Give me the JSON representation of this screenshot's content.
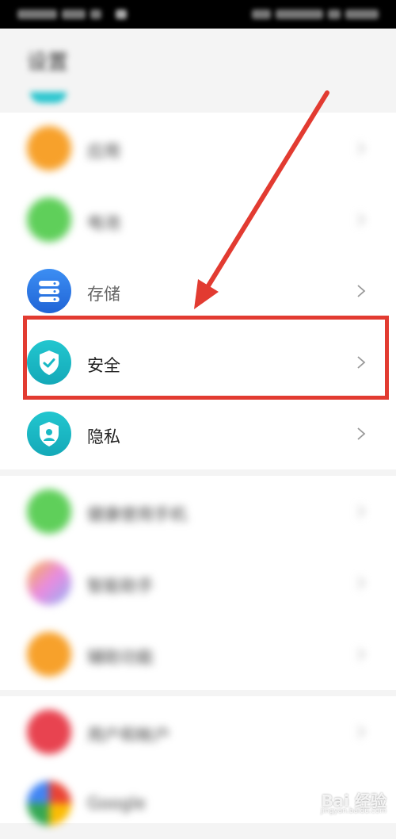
{
  "status_bar": {
    "left_text": "",
    "right_text": ""
  },
  "header": {
    "title": "设置"
  },
  "group1": {
    "items": [
      {
        "label": "应用",
        "icon": "apps-icon",
        "color": "#f7a12b",
        "blurred": true
      },
      {
        "label": "电池",
        "icon": "battery-icon",
        "color": "#5fcf5a",
        "blurred": true
      },
      {
        "label": "存储",
        "icon": "storage-icon",
        "color": "#2f7de8",
        "blurred": false
      },
      {
        "label": "安全",
        "icon": "shield-check-icon",
        "color": "#18b9c5",
        "blurred": false
      },
      {
        "label": "隐私",
        "icon": "privacy-shield-icon",
        "color": "#18b9c5",
        "blurred": false
      }
    ]
  },
  "group2": {
    "items": [
      {
        "label": "健康使用手机",
        "icon": "hourglass-icon",
        "color": "#5fcf5a",
        "blurred": true
      },
      {
        "label": "智能助手",
        "icon": "assistant-icon",
        "color": "#e98be0",
        "blurred": true
      },
      {
        "label": "辅助功能",
        "icon": "hand-icon",
        "color": "#f7a12b",
        "blurred": true
      }
    ]
  },
  "group3": {
    "items": [
      {
        "label": "用户和帐户",
        "icon": "user-icon",
        "color": "#e84350",
        "blurred": true
      },
      {
        "label": "Google",
        "icon": "google-icon",
        "color": "#4285f4",
        "blurred": true
      }
    ]
  },
  "annotation": {
    "box_color": "#e23b31",
    "arrow_color": "#e23b31"
  },
  "watermark": {
    "main": "Bai 经验",
    "sub": "jingyan.baidu.com"
  }
}
